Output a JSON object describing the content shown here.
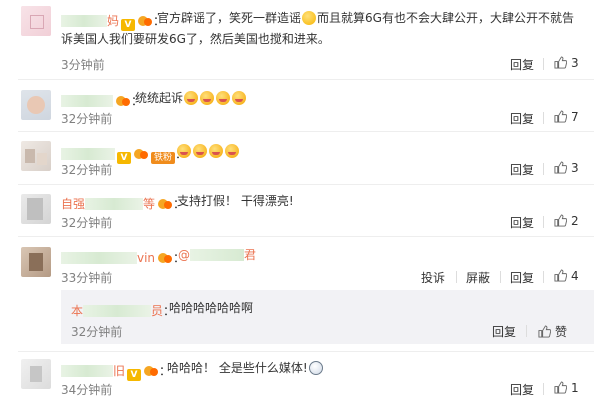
{
  "comments": [
    {
      "name_suffix": "妈",
      "text_line1": "官方辟谣了，笑死一群造谣",
      "text_line1b": "而且就算6G有也不会大肆公开，大肆公开不就告",
      "text_line2": "诉美国人我们要研发6G了，然后美国也搅和进来。",
      "time": "3分钟前",
      "reply_label": "回复",
      "likes": "3"
    },
    {
      "name_suffix": "",
      "text": "统统起诉",
      "time": "32分钟前",
      "reply_label": "回复",
      "likes": "7"
    },
    {
      "name_suffix": "",
      "fan_badge": "铁粉",
      "text": "",
      "time": "32分钟前",
      "reply_label": "回复",
      "likes": "3"
    },
    {
      "name_prefix": "自强",
      "name_suffix": "等",
      "text": "支持打假！ 干得漂亮!",
      "time": "32分钟前",
      "reply_label": "回复",
      "likes": "2"
    },
    {
      "name_suffix": "vin",
      "mention_suffix": "君",
      "text": "",
      "time": "33分钟前",
      "report_label": "投诉",
      "block_label": "屏蔽",
      "reply_label": "回复",
      "likes": "4"
    },
    {
      "name_suffix": "旧",
      "text": "哈哈哈！ 全是些什么媒体!",
      "time": "34分钟前",
      "reply_label": "回复",
      "likes": "1"
    }
  ],
  "nested_reply": {
    "name_prefix": "本",
    "name_suffix": "员",
    "text": "哈哈哈哈哈哈啊",
    "time": "32分钟前",
    "reply_label": "回复",
    "like_label": "赞"
  },
  "colors": {
    "username": "#eb7350",
    "time": "#808080",
    "text": "#333333",
    "reply_bg": "#f2f2f5"
  },
  "icons": [
    "thumb-up-icon",
    "vip-icon",
    "level-badge-icon",
    "emoji-icon"
  ]
}
